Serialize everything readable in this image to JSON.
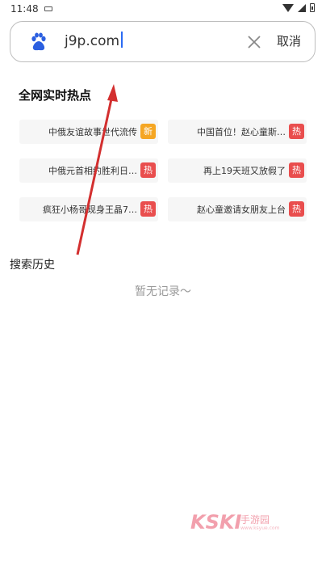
{
  "status_bar": {
    "time": "11:48"
  },
  "search": {
    "value": "j9p.com",
    "cancel_label": "取消"
  },
  "hot": {
    "title": "全网实时热点",
    "items": [
      {
        "text": "中俄友谊故事世代流传",
        "badge": "新",
        "badge_color": "#f5a623"
      },
      {
        "text": "中国首位！赵心童斯…",
        "badge": "热",
        "badge_color": "#e94e4e"
      },
      {
        "text": "中俄元首相约胜利日…",
        "badge": "热",
        "badge_color": "#e94e4e"
      },
      {
        "text": "再上19天班又放假了",
        "badge": "热",
        "badge_color": "#e94e4e"
      },
      {
        "text": "疯狂小杨哥现身王晶7…",
        "badge": "热",
        "badge_color": "#e94e4e"
      },
      {
        "text": "赵心童邀请女朋友上台",
        "badge": "热",
        "badge_color": "#e94e4e"
      }
    ]
  },
  "history": {
    "title": "搜索历史",
    "empty_text": "暂无记录～"
  },
  "watermark": {
    "logo": "KSKI",
    "cn": "手游园",
    "sub": "www.ksyue.com"
  },
  "colors": {
    "annotation_arrow": "#d32f2f",
    "baidu_blue": "#2b5fe0"
  }
}
